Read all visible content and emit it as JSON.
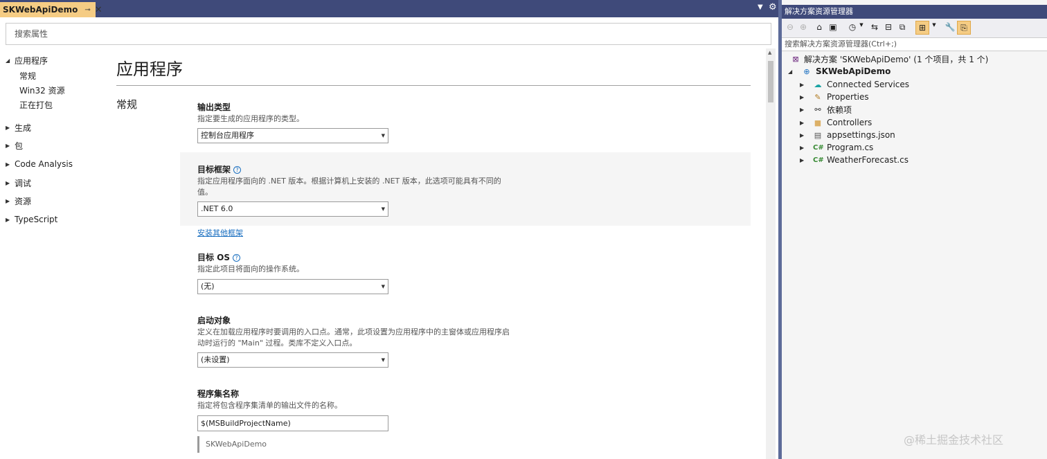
{
  "tab": {
    "title": "SKWebApiDemo",
    "pin": "⊸",
    "close": "✕"
  },
  "search_properties": {
    "placeholder": "搜索属性"
  },
  "nav": {
    "app": "应用程序",
    "app_children": [
      "常规",
      "Win32 资源",
      "正在打包"
    ],
    "others": [
      "生成",
      "包",
      "Code Analysis",
      "调试",
      "资源",
      "TypeScript"
    ]
  },
  "page": {
    "title": "应用程序",
    "section": "常规"
  },
  "output_type": {
    "label": "输出类型",
    "desc": "指定要生成的应用程序的类型。",
    "value": "控制台应用程序"
  },
  "target_framework": {
    "label": "目标框架",
    "desc": "指定应用程序面向的 .NET 版本。根据计算机上安装的 .NET 版本，此选项可能具有不同的值。",
    "value": ".NET 6.0",
    "link": "安装其他框架"
  },
  "target_os": {
    "label": "目标 OS",
    "desc": "指定此项目将面向的操作系统。",
    "value": "(无)"
  },
  "startup_object": {
    "label": "启动对象",
    "desc": "定义在加载应用程序时要调用的入口点。通常，此项设置为应用程序中的主窗体或应用程序启动时运行的 \"Main\" 过程。类库不定义入口点。",
    "value": "(未设置)"
  },
  "assembly_name": {
    "label": "程序集名称",
    "desc": "指定将包含程序集清单的输出文件的名称。",
    "value": "$(MSBuildProjectName)",
    "evaluated": "SKWebApiDemo"
  },
  "solution_explorer": {
    "title": "解决方案资源管理器",
    "search_placeholder": "搜索解决方案资源管理器(Ctrl+;)",
    "solution": "解决方案 'SKWebApiDemo' (1 个项目，共 1 个)",
    "project": "SKWebApiDemo",
    "items": [
      {
        "label": "Connected Services",
        "icon": "connected-services-icon"
      },
      {
        "label": "Properties",
        "icon": "wrench-icon"
      },
      {
        "label": "依赖项",
        "icon": "dependencies-icon"
      },
      {
        "label": "Controllers",
        "icon": "folder-icon"
      },
      {
        "label": "appsettings.json",
        "icon": "json-file-icon"
      },
      {
        "label": "Program.cs",
        "icon": "csharp-file-icon"
      },
      {
        "label": "WeatherForecast.cs",
        "icon": "csharp-file-icon"
      }
    ]
  },
  "watermark": "@稀土掘金技术社区",
  "colors": {
    "tab_active": "#f5cc84",
    "chrome": "#3f4a7a",
    "link": "#1a6fc0"
  }
}
